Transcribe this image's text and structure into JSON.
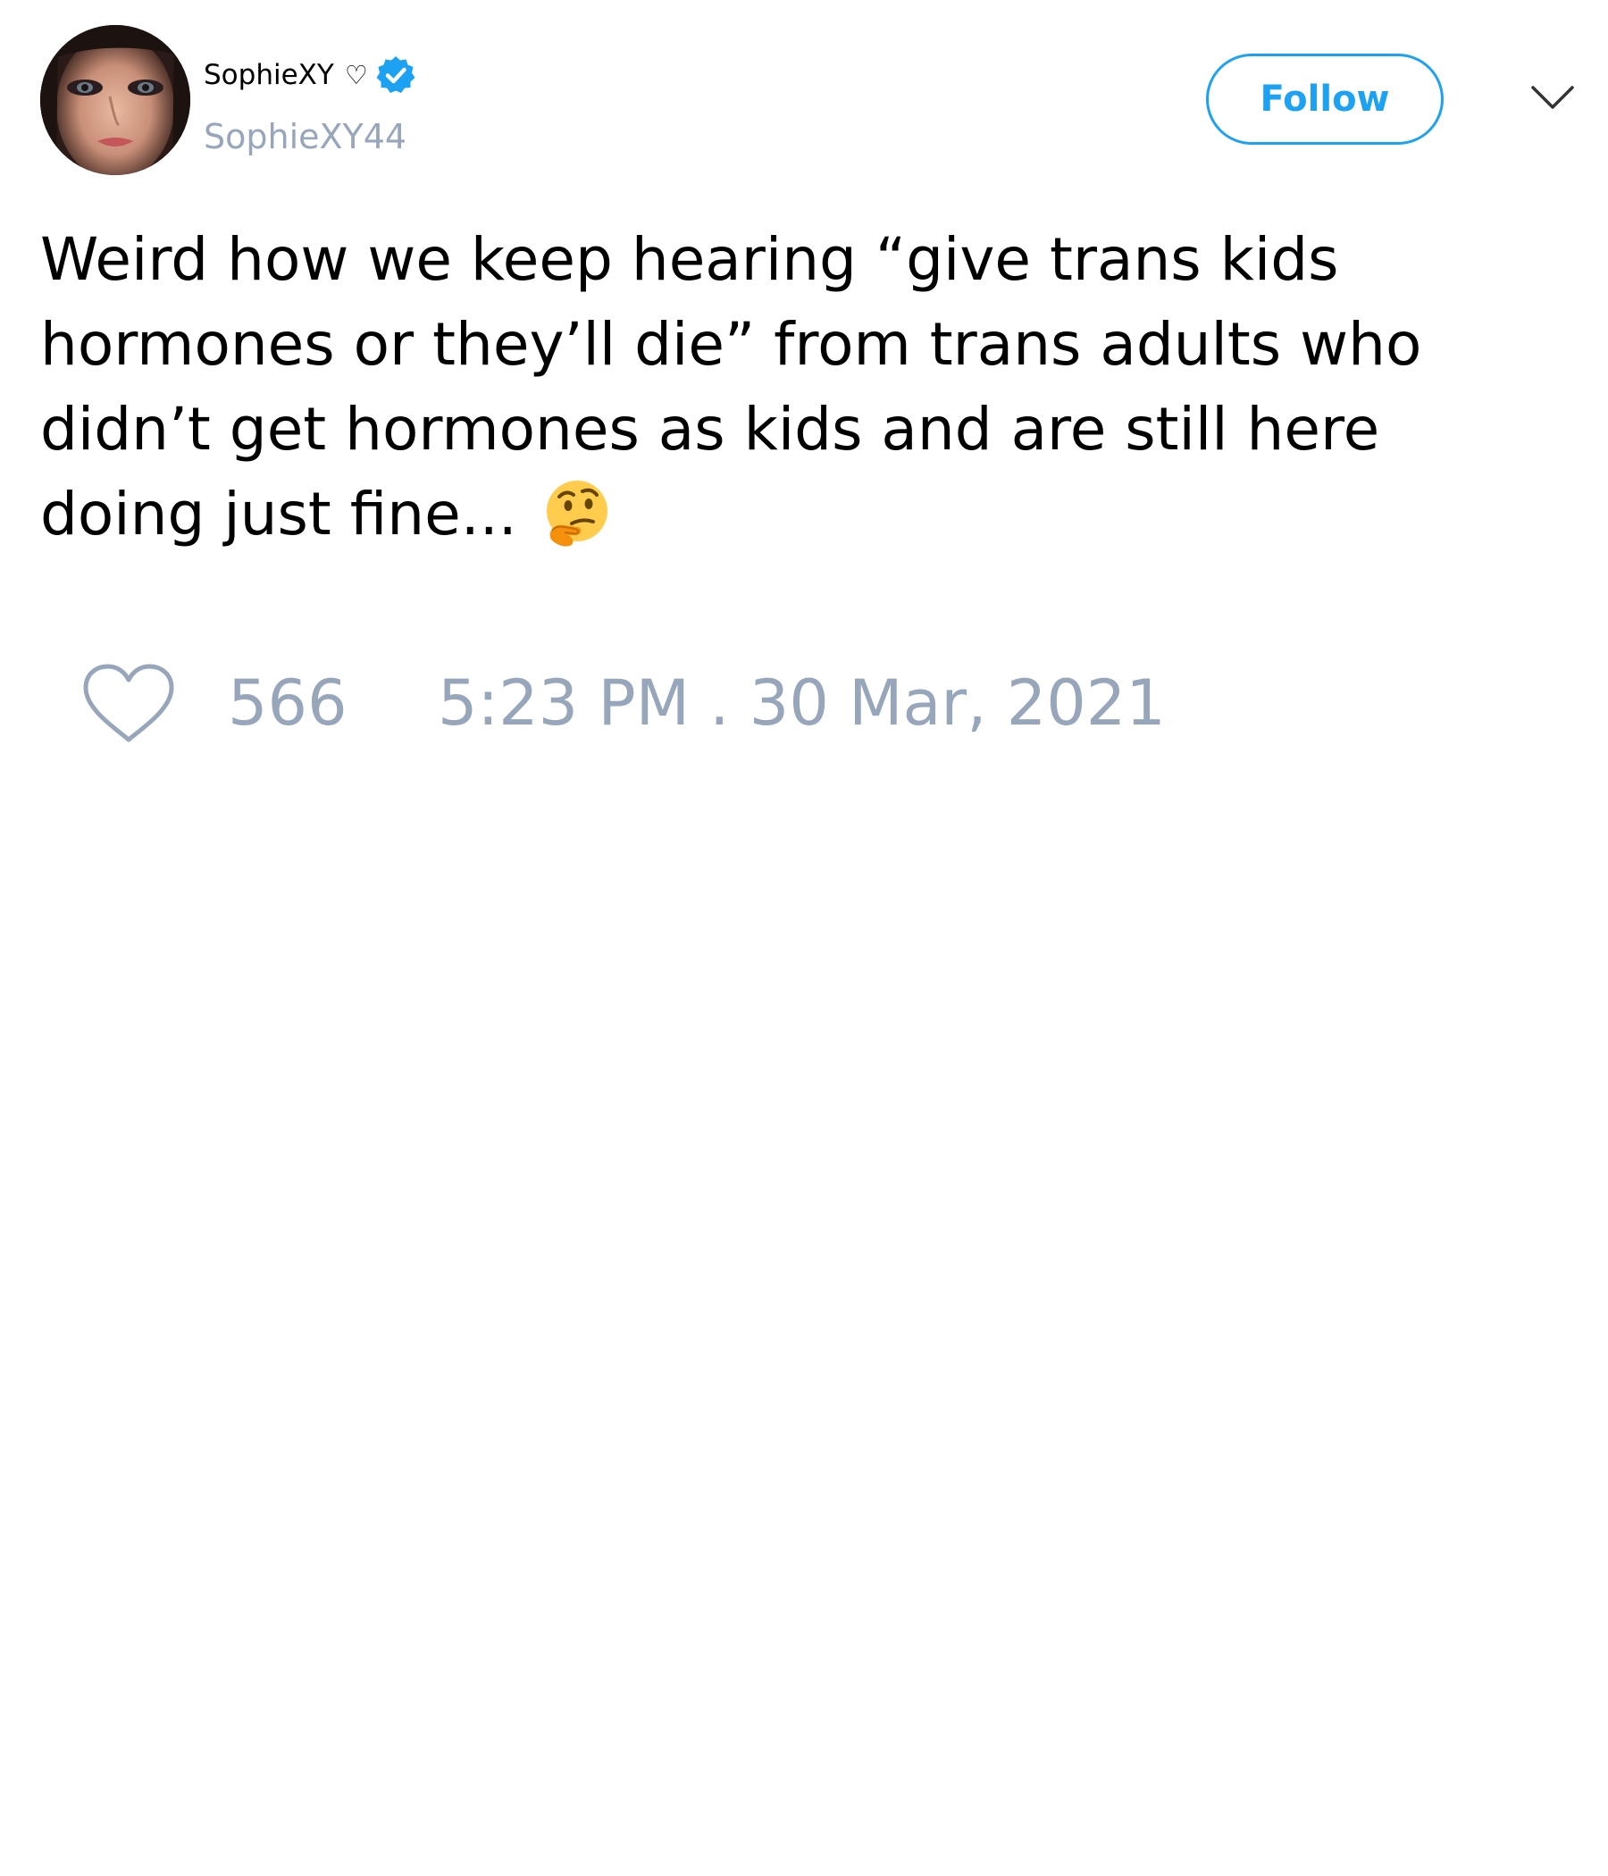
{
  "tweet": {
    "author": {
      "display_name": "SophieXY",
      "name_suffix_glyph": "♡",
      "verified": true,
      "username": "SophieXY44",
      "avatar_icon": "profile-photo"
    },
    "follow_button_label": "Follow",
    "more_icon": "chevron-down-icon",
    "text_lines": [
      "Weird how we keep hearing “give trans kids",
      "hormones or they’ll die” from trans adults who",
      "didn’t get hormones as kids and are still here",
      "doing just fine..."
    ],
    "trailing_emoji": "thinking-face-emoji",
    "likes": "566",
    "timestamp": "5:23 PM . 30 Mar, 2021"
  },
  "colors": {
    "accent": "#1da1f2",
    "secondary_text": "#97a6ba",
    "verified_badge": "#1da1f2",
    "text": "#000000",
    "background": "#ffffff"
  }
}
